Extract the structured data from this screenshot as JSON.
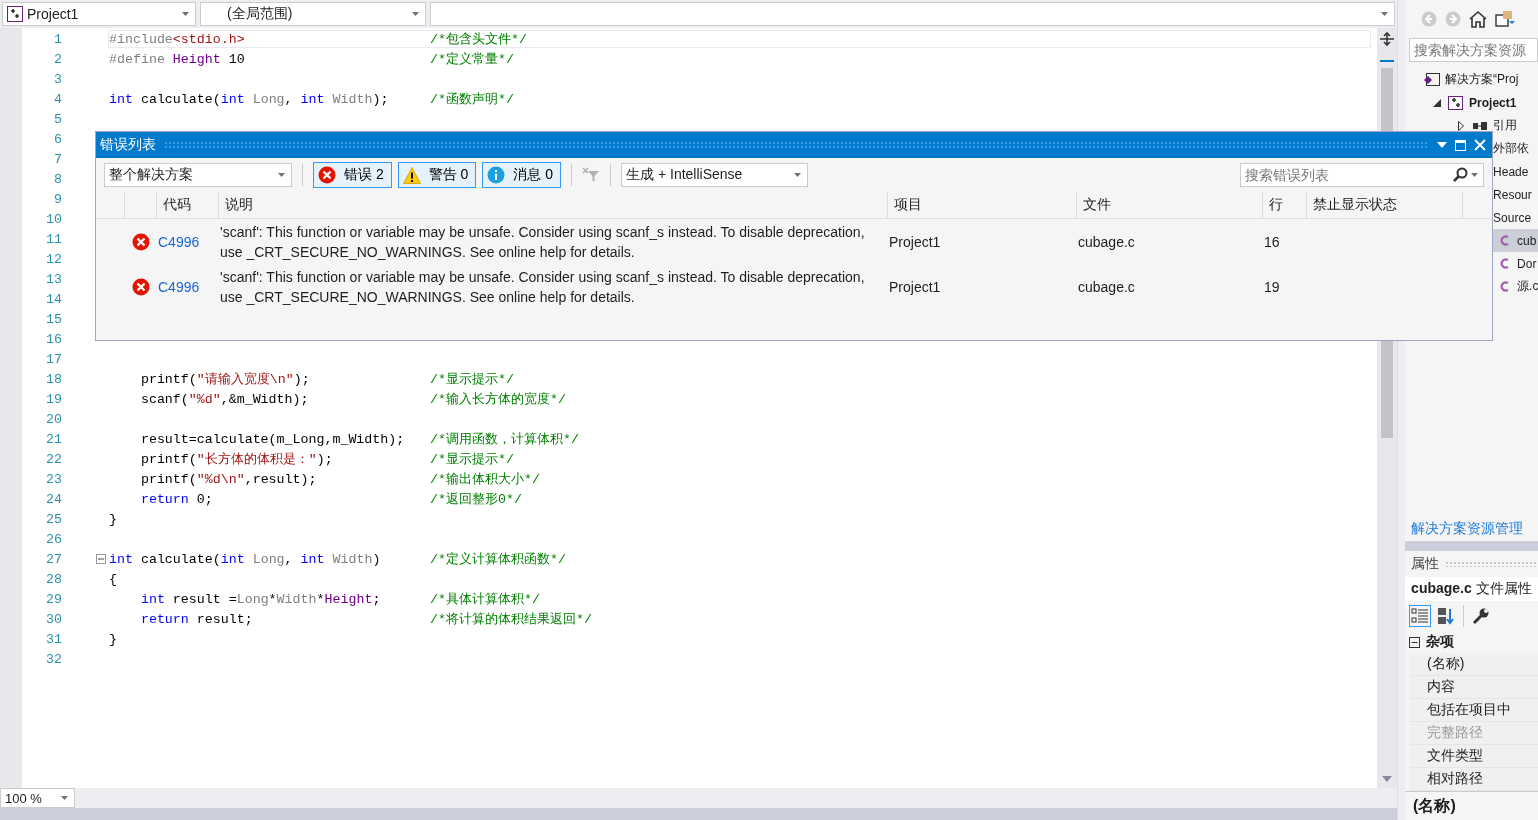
{
  "toolbar": {
    "project": "Project1",
    "scope": "(全局范围)"
  },
  "editor": {
    "zoom": "100 %",
    "lines": [
      {
        "number": "1",
        "current": true,
        "tokens": [
          {
            "kind": "pre",
            "text": "#include"
          },
          {
            "kind": "str",
            "text": "<stdio.h>"
          }
        ],
        "comment": "/*包含头文件*/"
      },
      {
        "number": "2",
        "current": false,
        "tokens": [
          {
            "kind": "pre",
            "text": "#define "
          },
          {
            "kind": "macro",
            "text": "Height"
          },
          {
            "kind": "plain",
            "text": " 10"
          }
        ],
        "comment": "/*定义常量*/"
      },
      {
        "number": "3",
        "current": false
      },
      {
        "number": "4",
        "current": false,
        "tokens": [
          {
            "kind": "kw",
            "text": "int"
          },
          {
            "kind": "plain",
            "text": " calculate("
          },
          {
            "kind": "kw",
            "text": "int"
          },
          {
            "kind": "param",
            "text": " Long"
          },
          {
            "kind": "plain",
            "text": ", "
          },
          {
            "kind": "kw",
            "text": "int"
          },
          {
            "kind": "param",
            "text": " Width"
          },
          {
            "kind": "plain",
            "text": ");"
          }
        ],
        "comment": "/*函数声明*/"
      },
      {
        "number": "5",
        "current": false
      },
      {
        "number": "6"
      },
      {
        "number": "7"
      },
      {
        "number": "8"
      },
      {
        "number": "9"
      },
      {
        "number": "10"
      },
      {
        "number": "11"
      },
      {
        "number": "12"
      },
      {
        "number": "13"
      },
      {
        "number": "14"
      },
      {
        "number": "15"
      },
      {
        "number": "16"
      },
      {
        "number": "17",
        "current": false
      },
      {
        "number": "18",
        "current": false,
        "tokens": [
          {
            "kind": "plain",
            "text": "    printf("
          },
          {
            "kind": "str",
            "text": "\"请输入宽度\\n\""
          },
          {
            "kind": "plain",
            "text": ");"
          }
        ],
        "comment": "/*显示提示*/"
      },
      {
        "number": "19",
        "current": false,
        "tokens": [
          {
            "kind": "plain",
            "text": "    scanf("
          },
          {
            "kind": "str",
            "text": "\"%d\""
          },
          {
            "kind": "plain",
            "text": ",&m_Width);"
          }
        ],
        "comment": "/*输入长方体的宽度*/"
      },
      {
        "number": "20",
        "current": false
      },
      {
        "number": "21",
        "current": false,
        "tokens": [
          {
            "kind": "plain",
            "text": "    result=calculate(m_Long,m_Width);"
          }
        ],
        "comment": "/*调用函数，计算体积*/"
      },
      {
        "number": "22",
        "current": false,
        "tokens": [
          {
            "kind": "plain",
            "text": "    printf("
          },
          {
            "kind": "str",
            "text": "\"长方体的体积是：\""
          },
          {
            "kind": "plain",
            "text": ");"
          }
        ],
        "comment": "/*显示提示*/"
      },
      {
        "number": "23",
        "current": false,
        "tokens": [
          {
            "kind": "plain",
            "text": "    printf("
          },
          {
            "kind": "str",
            "text": "\"%d\\n\""
          },
          {
            "kind": "plain",
            "text": ",result);"
          }
        ],
        "comment": "/*输出体积大小*/"
      },
      {
        "number": "24",
        "current": false,
        "tokens": [
          {
            "kind": "kw",
            "text": "    return"
          },
          {
            "kind": "plain",
            "text": " 0;"
          }
        ],
        "comment": "/*返回整形0*/"
      },
      {
        "number": "25",
        "current": false,
        "tokens": [
          {
            "kind": "plain",
            "text": "}"
          }
        ]
      },
      {
        "number": "26",
        "current": false
      },
      {
        "number": "27",
        "current": false,
        "expanded": true,
        "tokens": [
          {
            "kind": "kw",
            "text": "int"
          },
          {
            "kind": "plain",
            "text": " calculate("
          },
          {
            "kind": "kw",
            "text": "int"
          },
          {
            "kind": "param",
            "text": " Long"
          },
          {
            "kind": "plain",
            "text": ", "
          },
          {
            "kind": "kw",
            "text": "int"
          },
          {
            "kind": "param",
            "text": " Width"
          },
          {
            "kind": "plain",
            "text": ")"
          }
        ],
        "comment": "/*定义计算体积函数*/"
      },
      {
        "number": "28",
        "current": false,
        "tokens": [
          {
            "kind": "plain",
            "text": "{"
          }
        ]
      },
      {
        "number": "29",
        "current": false,
        "tokens": [
          {
            "kind": "kw",
            "text": "    int"
          },
          {
            "kind": "plain",
            "text": " result ="
          },
          {
            "kind": "param",
            "text": "Long"
          },
          {
            "kind": "plain",
            "text": "*"
          },
          {
            "kind": "param",
            "text": "Width"
          },
          {
            "kind": "plain",
            "text": "*"
          },
          {
            "kind": "macro",
            "text": "Height"
          },
          {
            "kind": "plain",
            "text": ";"
          }
        ],
        "comment": "/*具体计算体积*/"
      },
      {
        "number": "30",
        "current": false,
        "tokens": [
          {
            "kind": "kw",
            "text": "    return"
          },
          {
            "kind": "plain",
            "text": " result;"
          }
        ],
        "comment": "/*将计算的体积结果返回*/"
      },
      {
        "number": "31",
        "current": false,
        "tokens": [
          {
            "kind": "plain",
            "text": "}"
          }
        ]
      },
      {
        "number": "32",
        "current": false
      }
    ]
  },
  "error_list": {
    "title": "错误列表",
    "scope": "整个解决方案",
    "filters": [
      {
        "kind": "error",
        "label": "错误 2",
        "selected": true
      },
      {
        "kind": "warning",
        "label": "警告 0",
        "selected": true
      },
      {
        "kind": "info",
        "label": "消息 0",
        "selected": true
      }
    ],
    "build_filter": "生成 + IntelliSense",
    "search": {
      "placeholder": "搜索错误列表"
    },
    "columns": [
      "代码",
      "说明",
      "项目",
      "文件",
      "行",
      "禁止显示状态"
    ],
    "rows": [
      {
        "kind": "error",
        "code": "C4996",
        "description": "'scanf': This function or variable may be unsafe. Consider using scanf_s instead. To disable deprecation, use _CRT_SECURE_NO_WARNINGS. See online help for details.",
        "project": "Project1",
        "file": "cubage.c",
        "line": "16"
      },
      {
        "kind": "error",
        "code": "C4996",
        "description": "'scanf': This function or variable may be unsafe. Consider using scanf_s instead. To disable deprecation, use _CRT_SECURE_NO_WARNINGS. See online help for details.",
        "project": "Project1",
        "file": "cubage.c",
        "line": "19"
      }
    ]
  },
  "solution_explorer": {
    "search": {
      "placeholder": "搜索解决方案资源"
    },
    "tree": [
      {
        "kind": "solution",
        "label": "解决方案“Proj",
        "selected": false,
        "children": [
          {
            "kind": "project",
            "label": "Project1",
            "selected": false,
            "expanded": true,
            "children": [
              {
                "kind": "references",
                "label": "引用",
                "selected": false,
                "expanded": false
              },
              {
                "kind": "folder",
                "label": "外部依",
                "selected": false
              },
              {
                "kind": "folder",
                "label": "Heade",
                "selected": false
              },
              {
                "kind": "folder",
                "label": "Resour",
                "selected": false
              },
              {
                "kind": "folder",
                "label": "Source",
                "selected": false,
                "children": [
                  {
                    "kind": "file",
                    "label": "cub",
                    "selected": true
                  },
                  {
                    "kind": "file",
                    "label": "Dor",
                    "selected": false
                  },
                  {
                    "kind": "file",
                    "label": "源.c",
                    "selected": false
                  }
                ]
              }
            ]
          }
        ]
      }
    ],
    "tab": "解决方案资源管理"
  },
  "properties": {
    "title": "属性",
    "subject": "**cubage.c** 文件属性",
    "group": {
      "label": "杂项",
      "expanded": true
    },
    "items": [
      {
        "label": "(名称)",
        "disabled": false
      },
      {
        "label": "内容",
        "disabled": false
      },
      {
        "label": "包括在项目中",
        "disabled": false
      },
      {
        "label": "完整路径",
        "disabled": true
      },
      {
        "label": "文件类型",
        "disabled": false
      },
      {
        "label": "相对路径",
        "disabled": false
      }
    ],
    "description": "(名称)"
  }
}
